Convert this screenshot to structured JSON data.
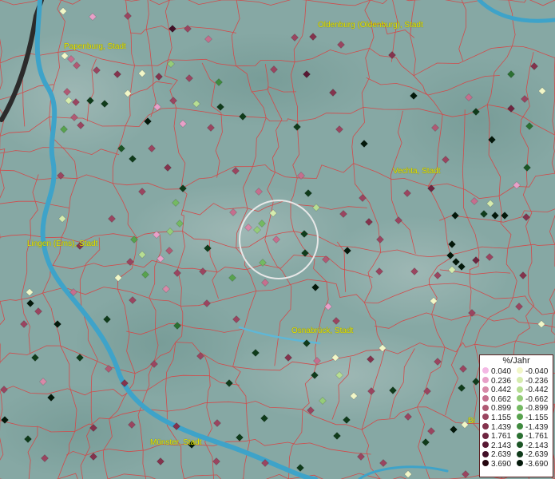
{
  "map": {
    "background_color": "#86a8a4",
    "border_color": "#d24a4a",
    "river_color": "#3ea3c9"
  },
  "cities": [
    {
      "id": "papenburg",
      "label": "Papenburg, Stadt"
    },
    {
      "id": "oldenburg",
      "label": "Oldenburg (Oldenburg), Stadt"
    },
    {
      "id": "vechta",
      "label": "Vechta, Stadt"
    },
    {
      "id": "lingen",
      "label": "Lingen (Ems), Stadt"
    },
    {
      "id": "osnabrueck",
      "label": "Osnabrück, Stadt"
    },
    {
      "id": "muenster",
      "label": "Münster, Stadt"
    },
    {
      "id": "bi",
      "label": "Bi"
    }
  ],
  "legend": {
    "title": "%/Jahr",
    "positive": [
      {
        "value": "0.040",
        "color": "#f4b8e4"
      },
      {
        "value": "0.236",
        "color": "#e8a0c8"
      },
      {
        "value": "0.442",
        "color": "#d889a8"
      },
      {
        "value": "0.662",
        "color": "#c56f8e"
      },
      {
        "value": "0.899",
        "color": "#b05a74"
      },
      {
        "value": "1.155",
        "color": "#9a4560"
      },
      {
        "value": "1.439",
        "color": "#84334d"
      },
      {
        "value": "1.761",
        "color": "#6e2540"
      },
      {
        "value": "2.143",
        "color": "#581833"
      },
      {
        "value": "2.639",
        "color": "#420f27"
      },
      {
        "value": "3.690",
        "color": "#25060f"
      }
    ],
    "negative": [
      {
        "value": "-0.040",
        "color": "#f2f7c8"
      },
      {
        "value": "-0.236",
        "color": "#d6ecae"
      },
      {
        "value": "-0.442",
        "color": "#b7de93"
      },
      {
        "value": "-0.662",
        "color": "#95cc79"
      },
      {
        "value": "-0.899",
        "color": "#74b962"
      },
      {
        "value": "-1.155",
        "color": "#58a24e"
      },
      {
        "value": "-1.439",
        "color": "#3f8a3e"
      },
      {
        "value": "-1.761",
        "color": "#2b7031"
      },
      {
        "value": "-2.143",
        "color": "#1b5525"
      },
      {
        "value": "-2.639",
        "color": "#0f3b1a"
      },
      {
        "value": "-3.690",
        "color": "#03180a"
      }
    ]
  },
  "highlight_ring": {
    "color": "#e8e8e8"
  }
}
